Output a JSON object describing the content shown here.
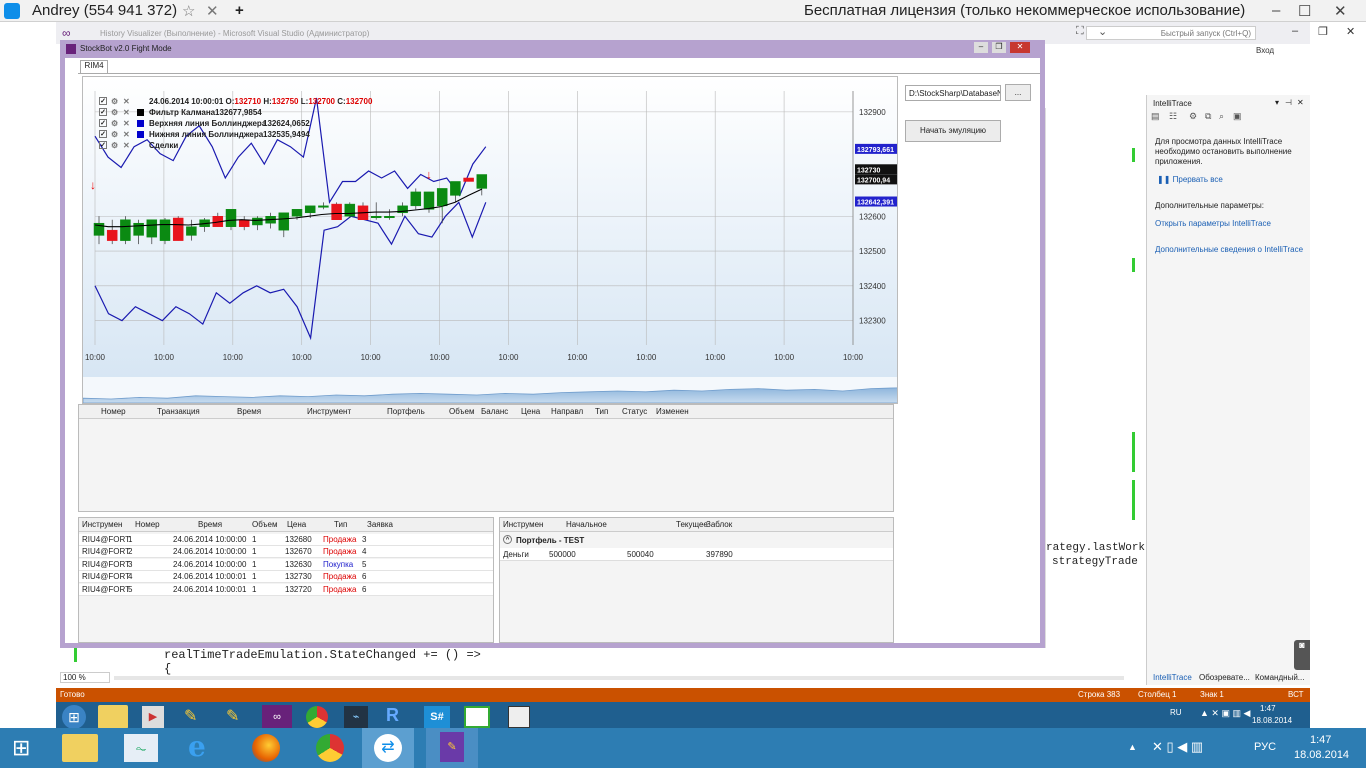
{
  "teamviewer": {
    "title": "Andrey (554 941 372)",
    "license": "Бесплатная лицензия (только некоммерческое использование)"
  },
  "vs": {
    "title": "History Visualizer (Выполнение) - Microsoft Visual Studio (Администратор)",
    "quick_launch": "Быстрый запуск (Ctrl+Q)",
    "signin": "Вход",
    "status": {
      "ready": "Готово",
      "line": "Строка 383",
      "col": "Столбец 1",
      "char": "Знак 1",
      "mode": "ВСТ"
    },
    "zoom": "100 %",
    "code_lines": [
      "realTimeTradeEmulation.StateChanged += () =>",
      "{"
    ],
    "code_right": [
      "rategy.lastWork",
      "strategyTrade"
    ],
    "side_tabs": [
      "IntelliTrace",
      "Обозревате...",
      "Командный..."
    ]
  },
  "intellitrace": {
    "title": "IntelliTrace",
    "desc": "Для просмотра данных IntelliTrace необходимо остановить выполнение приложения.",
    "pause_all": "Прервать все",
    "extra_params": "Дополнительные параметры:",
    "open_params": "Открыть параметры IntelliTrace",
    "more_info": "Дополнительные сведения о IntelliTrace"
  },
  "app": {
    "title": "StockBot v2.0 Fight Mode",
    "tab": "RIM4",
    "path": "D:\\StockSharp\\DatabaseNe",
    "browse": "...",
    "start_emulation": "Начать эмуляцию"
  },
  "chart_data": {
    "type": "candlestick",
    "header": {
      "date": "24.06.2014 10:00:01",
      "o_label": "O:",
      "o": "132710",
      "h_label": "H:",
      "h": "132750",
      "l_label": "L:",
      "l": "132700",
      "c_label": "C:",
      "c": "132700"
    },
    "legend": [
      {
        "name": "Фильтр Калмана",
        "value": "132677,9854",
        "color": "#000000"
      },
      {
        "name": "Верхняя линия Боллинджера",
        "value": "132624,0652",
        "color": "#0000cc"
      },
      {
        "name": "Нижняя линия Боллинджера",
        "value": "132535,9494",
        "color": "#0000cc"
      },
      {
        "name": "Сделки",
        "value": "",
        "color": "#888888"
      }
    ],
    "y_ticks": [
      "132900",
      "132600",
      "132500",
      "132400",
      "132300"
    ],
    "y_tick_values": [
      132900,
      132600,
      132500,
      132400,
      132300
    ],
    "ylim": [
      132230,
      132960
    ],
    "badges": [
      {
        "text": "132793,661",
        "value": 132793.661,
        "color": "#2222cc"
      },
      {
        "text": "132730",
        "value": 132735,
        "color": "#111111"
      },
      {
        "text": "132700,94",
        "value": 132706,
        "color": "#111111"
      },
      {
        "text": "132642,391",
        "value": 132642.391,
        "color": "#2222cc"
      }
    ],
    "x_ticks": [
      "10:00",
      "10:00",
      "10:00",
      "10:00",
      "10:00",
      "10:00",
      "10:00",
      "10:00",
      "10:00",
      "10:00",
      "10:00",
      "10:00"
    ],
    "candles": [
      {
        "o": 132545,
        "h": 132600,
        "l": 132520,
        "c": 132580
      },
      {
        "o": 132560,
        "h": 132590,
        "l": 132520,
        "c": 132530
      },
      {
        "o": 132530,
        "h": 132600,
        "l": 132520,
        "c": 132590
      },
      {
        "o": 132545,
        "h": 132590,
        "l": 132520,
        "c": 132580
      },
      {
        "o": 132540,
        "h": 132590,
        "l": 132520,
        "c": 132590
      },
      {
        "o": 132530,
        "h": 132595,
        "l": 132520,
        "c": 132590
      },
      {
        "o": 132595,
        "h": 132600,
        "l": 132530,
        "c": 132530
      },
      {
        "o": 132545,
        "h": 132590,
        "l": 132530,
        "c": 132570
      },
      {
        "o": 132570,
        "h": 132595,
        "l": 132555,
        "c": 132590
      },
      {
        "o": 132600,
        "h": 132610,
        "l": 132570,
        "c": 132570
      },
      {
        "o": 132570,
        "h": 132620,
        "l": 132560,
        "c": 132620
      },
      {
        "o": 132590,
        "h": 132600,
        "l": 132560,
        "c": 132570
      },
      {
        "o": 132575,
        "h": 132600,
        "l": 132560,
        "c": 132595
      },
      {
        "o": 132580,
        "h": 132610,
        "l": 132565,
        "c": 132600
      },
      {
        "o": 132560,
        "h": 132610,
        "l": 132540,
        "c": 132610
      },
      {
        "o": 132600,
        "h": 132620,
        "l": 132590,
        "c": 132620
      },
      {
        "o": 132610,
        "h": 132630,
        "l": 132595,
        "c": 132630
      },
      {
        "o": 132630,
        "h": 132640,
        "l": 132620,
        "c": 132630
      },
      {
        "o": 132635,
        "h": 132640,
        "l": 132590,
        "c": 132590
      },
      {
        "o": 132600,
        "h": 132640,
        "l": 132595,
        "c": 132635
      },
      {
        "o": 132630,
        "h": 132640,
        "l": 132590,
        "c": 132590
      },
      {
        "o": 132600,
        "h": 132640,
        "l": 132590,
        "c": 132600
      },
      {
        "o": 132600,
        "h": 132620,
        "l": 132590,
        "c": 132600
      },
      {
        "o": 132610,
        "h": 132640,
        "l": 132600,
        "c": 132630
      },
      {
        "o": 132630,
        "h": 132680,
        "l": 132620,
        "c": 132670
      },
      {
        "o": 132620,
        "h": 132670,
        "l": 132610,
        "c": 132670
      },
      {
        "o": 132630,
        "h": 132680,
        "l": 132580,
        "c": 132680
      },
      {
        "o": 132660,
        "h": 132700,
        "l": 132640,
        "c": 132700
      },
      {
        "o": 132710,
        "h": 132710,
        "l": 132700,
        "c": 132700
      },
      {
        "o": 132680,
        "h": 132720,
        "l": 132660,
        "c": 132720
      }
    ],
    "kalman": [
      132575,
      132570,
      132570,
      132572,
      132574,
      132576,
      132576,
      132575,
      132578,
      132582,
      132588,
      132590,
      132588,
      132590,
      132592,
      132595,
      132600,
      132605,
      132608,
      132608,
      132610,
      132612,
      132612,
      132614,
      132618,
      132622,
      132628,
      132640,
      132660,
      132678
    ],
    "bb_upper": [
      132830,
      132770,
      132740,
      132800,
      132820,
      132780,
      132760,
      132830,
      132860,
      132800,
      132710,
      132770,
      132810,
      132750,
      132820,
      132800,
      132770,
      132940,
      132640,
      132700,
      132700,
      132730,
      132710,
      132730,
      132680,
      132720,
      132700,
      132710,
      132660,
      132750,
      132800
    ],
    "bb_lower": [
      132400,
      132320,
      132300,
      132340,
      132320,
      132300,
      132340,
      132320,
      132290,
      132380,
      132350,
      132380,
      132400,
      132380,
      132390,
      132340,
      132250,
      132560,
      132570,
      132600,
      132590,
      132580,
      132520,
      132600,
      132550,
      132540,
      132600,
      132640,
      132540,
      132640
    ],
    "trades": [
      {
        "index": 0,
        "side": "sell",
        "price": 132690
      },
      {
        "index": 25,
        "side": "sell",
        "price": 132720
      },
      {
        "index": 26,
        "side": "buy",
        "price": 132630
      }
    ],
    "overview": [
      0.3,
      0.25,
      0.35,
      0.3,
      0.45,
      0.4,
      0.35,
      0.45,
      0.4,
      0.5,
      0.45,
      0.55,
      0.6,
      0.55,
      0.5,
      0.6,
      0.55,
      0.65,
      0.7,
      0.75,
      0.7,
      0.8,
      0.75,
      0.85,
      0.9,
      0.8,
      0.85,
      0.75,
      0.9,
      0.95
    ]
  },
  "orders_table": {
    "headers": [
      "Номер",
      "Транзакция",
      "Время",
      "Инструмент",
      "Портфель",
      "Объем",
      "Баланс",
      "Цена",
      "Направл",
      "Тип",
      "Статус",
      "Изменен"
    ]
  },
  "trades_table": {
    "headers": [
      "Инструмен",
      "Номер",
      "Время",
      "Объем",
      "Цена",
      "Тип",
      "Заявка"
    ],
    "rows": [
      [
        "RIU4@FORT",
        "1",
        "24.06.2014 10:00:00",
        "1",
        "132680",
        "Продажа",
        "3"
      ],
      [
        "RIU4@FORT",
        "2",
        "24.06.2014 10:00:00",
        "1",
        "132670",
        "Продажа",
        "4"
      ],
      [
        "RIU4@FORT",
        "3",
        "24.06.2014 10:00:00",
        "1",
        "132630",
        "Покупка",
        "5"
      ],
      [
        "RIU4@FORT",
        "4",
        "24.06.2014 10:00:01",
        "1",
        "132730",
        "Продажа",
        "6"
      ],
      [
        "RIU4@FORT",
        "5",
        "24.06.2014 10:00:01",
        "1",
        "132720",
        "Продажа",
        "6"
      ]
    ],
    "sell_color": "#dd0000",
    "buy_color": "#2222cc"
  },
  "portfolio_table": {
    "headers": [
      "Инструмен",
      "Начальное",
      "Текущее",
      "Заблок"
    ],
    "group": "Портфель - TEST",
    "row": [
      "Деньги",
      "500000",
      "500040",
      "397890"
    ]
  },
  "remote_tray": {
    "lang": "RU",
    "time": "1:47",
    "date": "18.08.2014"
  },
  "local_tray": {
    "lang": "РУС",
    "time": "1:47",
    "date": "18.08.2014"
  }
}
